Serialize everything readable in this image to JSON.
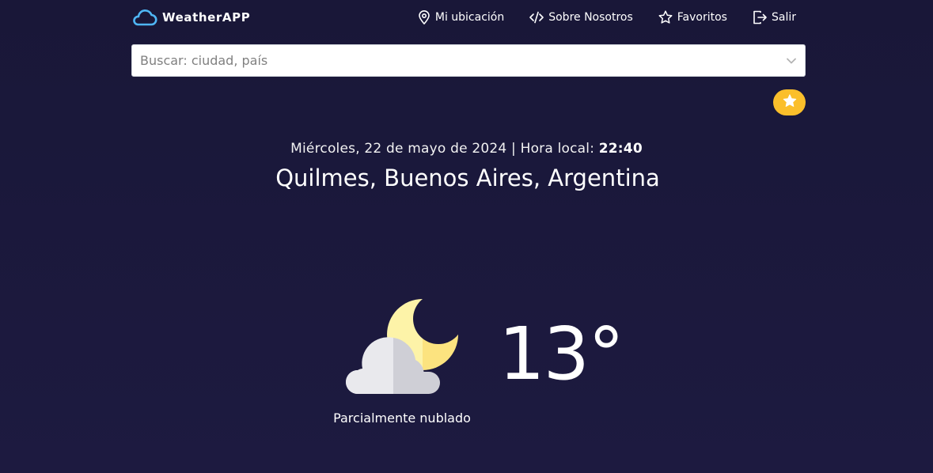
{
  "brand": {
    "name": "WeatherAPP",
    "logo_icon": "cloud-icon"
  },
  "nav": {
    "items": [
      {
        "label": "Mi ubicación",
        "icon": "map-pin-icon"
      },
      {
        "label": "Sobre Nosotros",
        "icon": "code-icon"
      },
      {
        "label": "Favoritos",
        "icon": "star-icon"
      },
      {
        "label": "Salir",
        "icon": "logout-icon"
      }
    ]
  },
  "search": {
    "placeholder": "Buscar: ciudad, país",
    "value": ""
  },
  "favorite_button": {
    "icon": "star-icon",
    "color": "#fbbf2b"
  },
  "header": {
    "date_text": "Miércoles, 22 de mayo de 2024 | Hora local: ",
    "local_time": "22:40",
    "location": "Quilmes, Buenos Aires, Argentina"
  },
  "weather": {
    "icon": "partly-cloudy-night-icon",
    "temperature": "13°",
    "condition": "Parcialmente nublado"
  },
  "colors": {
    "background": "#1b1739",
    "accent": "#fbbf2b",
    "logo": "#4fb6f5"
  }
}
